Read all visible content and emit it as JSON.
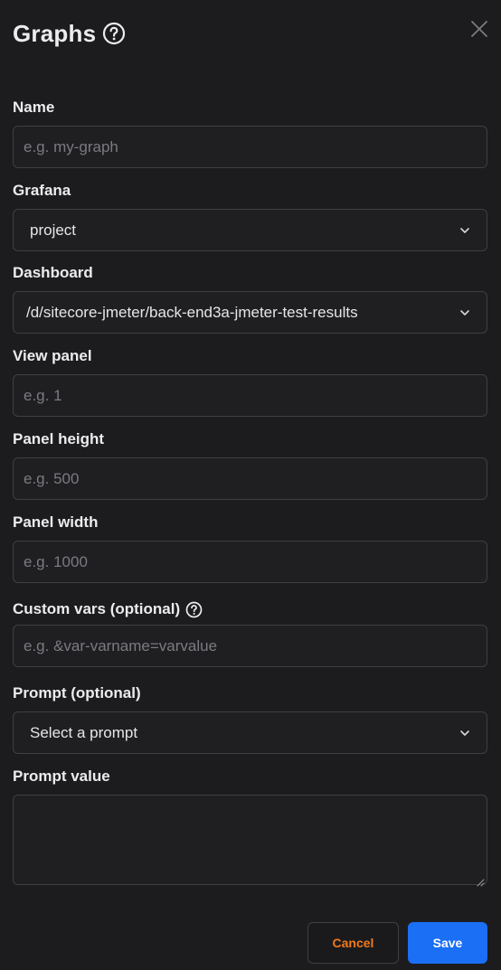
{
  "header": {
    "title": "Graphs",
    "help_icon": "question-circle-icon",
    "close_icon": "close-icon"
  },
  "fields": {
    "name": {
      "label": "Name",
      "placeholder": "e.g. my-graph",
      "value": ""
    },
    "grafana": {
      "label": "Grafana",
      "value": "project"
    },
    "dashboard": {
      "label": "Dashboard",
      "value": "/d/sitecore-jmeter/back-end3a-jmeter-test-results"
    },
    "view_panel": {
      "label": "View panel",
      "placeholder": "e.g. 1",
      "value": ""
    },
    "panel_height": {
      "label": "Panel height",
      "placeholder": "e.g. 500",
      "value": ""
    },
    "panel_width": {
      "label": "Panel width",
      "placeholder": "e.g. 1000",
      "value": ""
    },
    "custom_vars": {
      "label": "Custom vars (optional)",
      "placeholder": "e.g. &var-varname=varvalue",
      "value": ""
    },
    "prompt": {
      "label": "Prompt (optional)",
      "value": "Select a prompt"
    },
    "prompt_value": {
      "label": "Prompt value",
      "value": ""
    }
  },
  "footer": {
    "cancel_label": "Cancel",
    "save_label": "Save"
  },
  "colors": {
    "background": "#1c1c1f",
    "border": "#3e3e44",
    "primary": "#1a6ff5",
    "cancel_text": "#f07a1a"
  }
}
